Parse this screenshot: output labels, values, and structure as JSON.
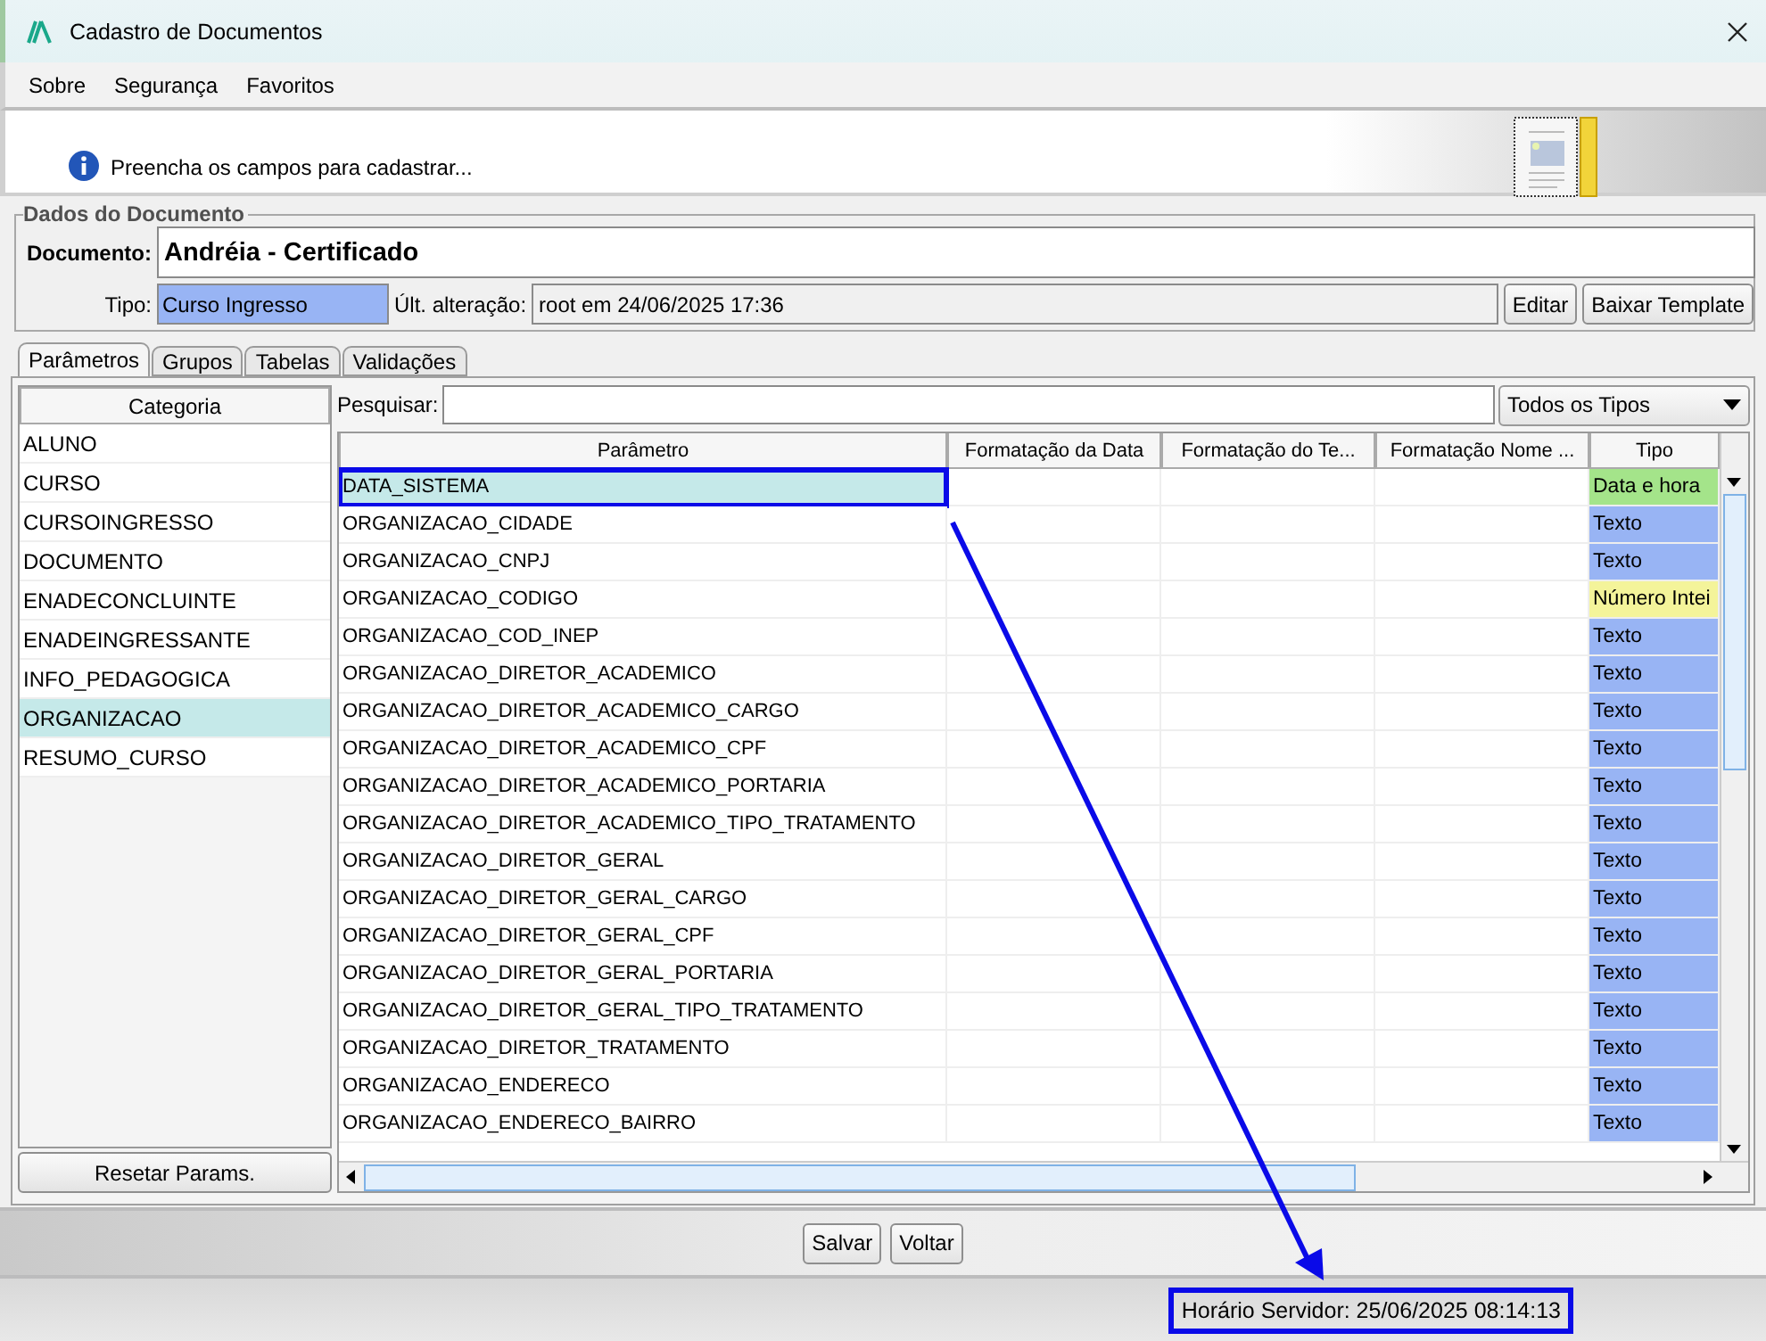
{
  "window": {
    "title": "Cadastro de Documentos"
  },
  "menu": [
    "Sobre",
    "Segurança",
    "Favoritos"
  ],
  "banner": {
    "message": "Preencha os campos para cadastrar..."
  },
  "document_group": {
    "title": "Dados do Documento",
    "document_label": "Documento:",
    "document_value": "Andréia - Certificado",
    "type_label": "Tipo:",
    "type_value": "Curso Ingresso",
    "changed_label": "Últ. alteração:",
    "changed_value": "root em 24/06/2025 17:36",
    "buttons": [
      "Editar",
      "Baixar Template"
    ]
  },
  "tabs": [
    {
      "label": "Parâmetros",
      "selected": true
    },
    {
      "label": "Grupos",
      "selected": false
    },
    {
      "label": "Tabelas",
      "selected": false
    },
    {
      "label": "Validações",
      "selected": false
    }
  ],
  "categories": {
    "header": "Categoria",
    "items": [
      {
        "label": "ALUNO",
        "selected": false
      },
      {
        "label": "CURSO",
        "selected": false
      },
      {
        "label": "CURSOINGRESSO",
        "selected": false
      },
      {
        "label": "DOCUMENTO",
        "selected": false
      },
      {
        "label": "ENADECONCLUINTE",
        "selected": false
      },
      {
        "label": "ENADEINGRESSANTE",
        "selected": false
      },
      {
        "label": "INFO_PEDAGOGICA",
        "selected": false
      },
      {
        "label": "ORGANIZACAO",
        "selected": true
      },
      {
        "label": "RESUMO_CURSO",
        "selected": false
      }
    ],
    "reset_button": "Resetar Params."
  },
  "search": {
    "label": "Pesquisar:",
    "filter": "Todos os Tipos"
  },
  "table": {
    "columns": [
      "Parâmetro",
      "Formatação da Data",
      "Formatação do Te...",
      "Formatação Nome ...",
      "Tipo"
    ],
    "rows": [
      {
        "name": "DATA_SISTEMA",
        "type": "Data e hora",
        "color": "#a4e48a",
        "selected": true,
        "highlighted": true
      },
      {
        "name": "ORGANIZACAO_CIDADE",
        "type": "Texto",
        "color": "#98b4f4",
        "selected": false,
        "highlighted": false
      },
      {
        "name": "ORGANIZACAO_CNPJ",
        "type": "Texto",
        "color": "#98b4f4",
        "selected": false,
        "highlighted": false
      },
      {
        "name": "ORGANIZACAO_CODIGO",
        "type": "Número Intei",
        "color": "#f4f49a",
        "selected": false,
        "highlighted": false
      },
      {
        "name": "ORGANIZACAO_COD_INEP",
        "type": "Texto",
        "color": "#98b4f4",
        "selected": false,
        "highlighted": false
      },
      {
        "name": "ORGANIZACAO_DIRETOR_ACADEMICO",
        "type": "Texto",
        "color": "#98b4f4",
        "selected": false,
        "highlighted": false
      },
      {
        "name": "ORGANIZACAO_DIRETOR_ACADEMICO_CARGO",
        "type": "Texto",
        "color": "#98b4f4",
        "selected": false,
        "highlighted": false
      },
      {
        "name": "ORGANIZACAO_DIRETOR_ACADEMICO_CPF",
        "type": "Texto",
        "color": "#98b4f4",
        "selected": false,
        "highlighted": false
      },
      {
        "name": "ORGANIZACAO_DIRETOR_ACADEMICO_PORTARIA",
        "type": "Texto",
        "color": "#98b4f4",
        "selected": false,
        "highlighted": false
      },
      {
        "name": "ORGANIZACAO_DIRETOR_ACADEMICO_TIPO_TRATAMENTO",
        "type": "Texto",
        "color": "#98b4f4",
        "selected": false,
        "highlighted": false
      },
      {
        "name": "ORGANIZACAO_DIRETOR_GERAL",
        "type": "Texto",
        "color": "#98b4f4",
        "selected": false,
        "highlighted": false
      },
      {
        "name": "ORGANIZACAO_DIRETOR_GERAL_CARGO",
        "type": "Texto",
        "color": "#98b4f4",
        "selected": false,
        "highlighted": false
      },
      {
        "name": "ORGANIZACAO_DIRETOR_GERAL_CPF",
        "type": "Texto",
        "color": "#98b4f4",
        "selected": false,
        "highlighted": false
      },
      {
        "name": "ORGANIZACAO_DIRETOR_GERAL_PORTARIA",
        "type": "Texto",
        "color": "#98b4f4",
        "selected": false,
        "highlighted": false
      },
      {
        "name": "ORGANIZACAO_DIRETOR_GERAL_TIPO_TRATAMENTO",
        "type": "Texto",
        "color": "#98b4f4",
        "selected": false,
        "highlighted": false
      },
      {
        "name": "ORGANIZACAO_DIRETOR_TRATAMENTO",
        "type": "Texto",
        "color": "#98b4f4",
        "selected": false,
        "highlighted": false
      },
      {
        "name": "ORGANIZACAO_ENDERECO",
        "type": "Texto",
        "color": "#98b4f4",
        "selected": false,
        "highlighted": false
      },
      {
        "name": "ORGANIZACAO_ENDERECO_BAIRRO",
        "type": "Texto",
        "color": "#98b4f4",
        "selected": false,
        "highlighted": false
      }
    ]
  },
  "buttons": [
    "Salvar",
    "Voltar"
  ],
  "status_bar": {
    "text": "Horário Servidor: 25/06/2025 08:14:13",
    "highlighted": true
  }
}
